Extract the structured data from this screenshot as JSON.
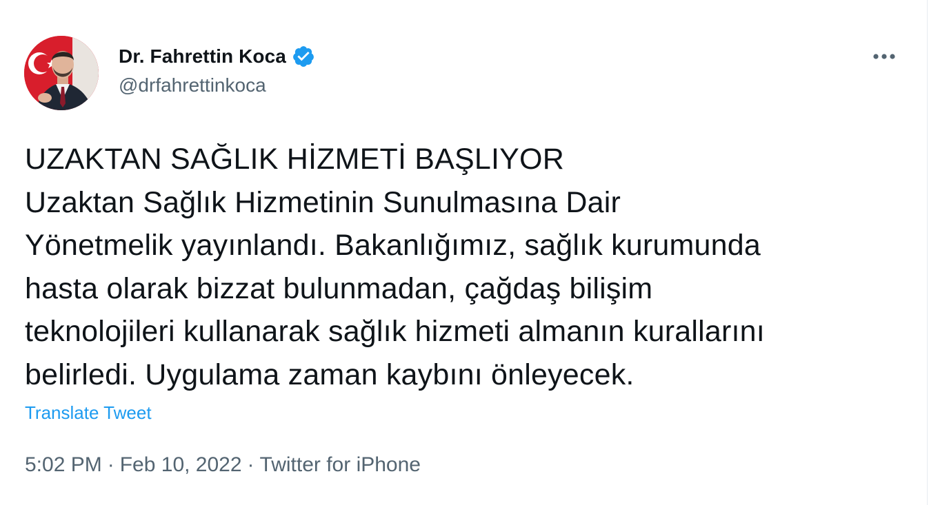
{
  "author": {
    "name": "Dr. Fahrettin Koca",
    "handle": "@drfahrettinkoca",
    "verified": true,
    "verified_badge_color": "#1d9bf0"
  },
  "more_icon": "more-horizontal-icon",
  "tweet": {
    "text": "UZAKTAN SAĞLIK HİZMETİ BAŞLIYOR\nUzaktan Sağlık Hizmetinin Sunulmasına Dair\nYönetmelik yayınlandı. Bakanlığımız, sağlık kurumunda\nhasta olarak bizzat bulunmadan, çağdaş bilişim\nteknolojileri kullanarak sağlık hizmeti almanın kurallarını\nbelirledi. Uygulama zaman kaybını önleyecek.",
    "translate_label": "Translate Tweet",
    "time": "5:02 PM",
    "separator": "·",
    "date": "Feb 10, 2022",
    "source": "Twitter for iPhone"
  },
  "colors": {
    "text": "#0f1419",
    "secondary_text": "#536471",
    "link": "#1d9bf0"
  }
}
